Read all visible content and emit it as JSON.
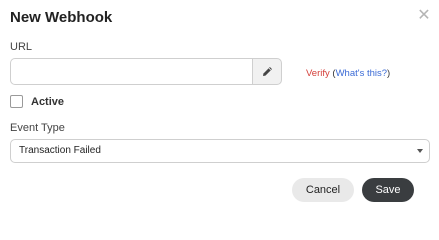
{
  "dialog": {
    "title": "New Webhook",
    "close_icon": "close-icon"
  },
  "url": {
    "label": "URL",
    "value": "",
    "placeholder": "",
    "edit_icon": "pencil-icon"
  },
  "verify": {
    "label": "Verify",
    "open_paren": "(",
    "whats_this": "What's this?",
    "close_paren": ")"
  },
  "active": {
    "label": "Active",
    "checked": false
  },
  "event_type": {
    "label": "Event Type",
    "selected": "Transaction Failed"
  },
  "actions": {
    "cancel_label": "Cancel",
    "save_label": "Save"
  },
  "colors": {
    "verify": "#d43f3a",
    "link": "#3b6bd6",
    "save_button": "#3a3d40",
    "cancel_button": "#e9e9e9"
  }
}
